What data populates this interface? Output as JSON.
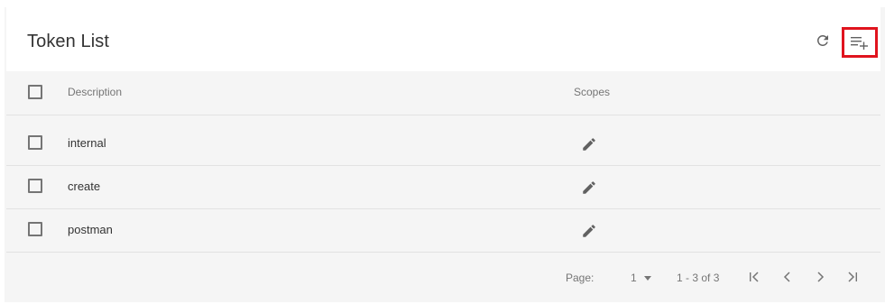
{
  "header": {
    "title": "Token List",
    "refresh_icon": "refresh-icon",
    "add_icon": "playlist-add-icon",
    "highlight_color": "#e0141e"
  },
  "table": {
    "columns": [
      "Description",
      "Scopes"
    ],
    "rows": [
      {
        "description": "internal",
        "scopes_icon": "pencil-icon"
      },
      {
        "description": "create",
        "scopes_icon": "pencil-icon"
      },
      {
        "description": "postman",
        "scopes_icon": "pencil-icon"
      }
    ]
  },
  "pagination": {
    "page_label": "Page:",
    "current_page": "1",
    "range": "1 - 3 of 3"
  }
}
